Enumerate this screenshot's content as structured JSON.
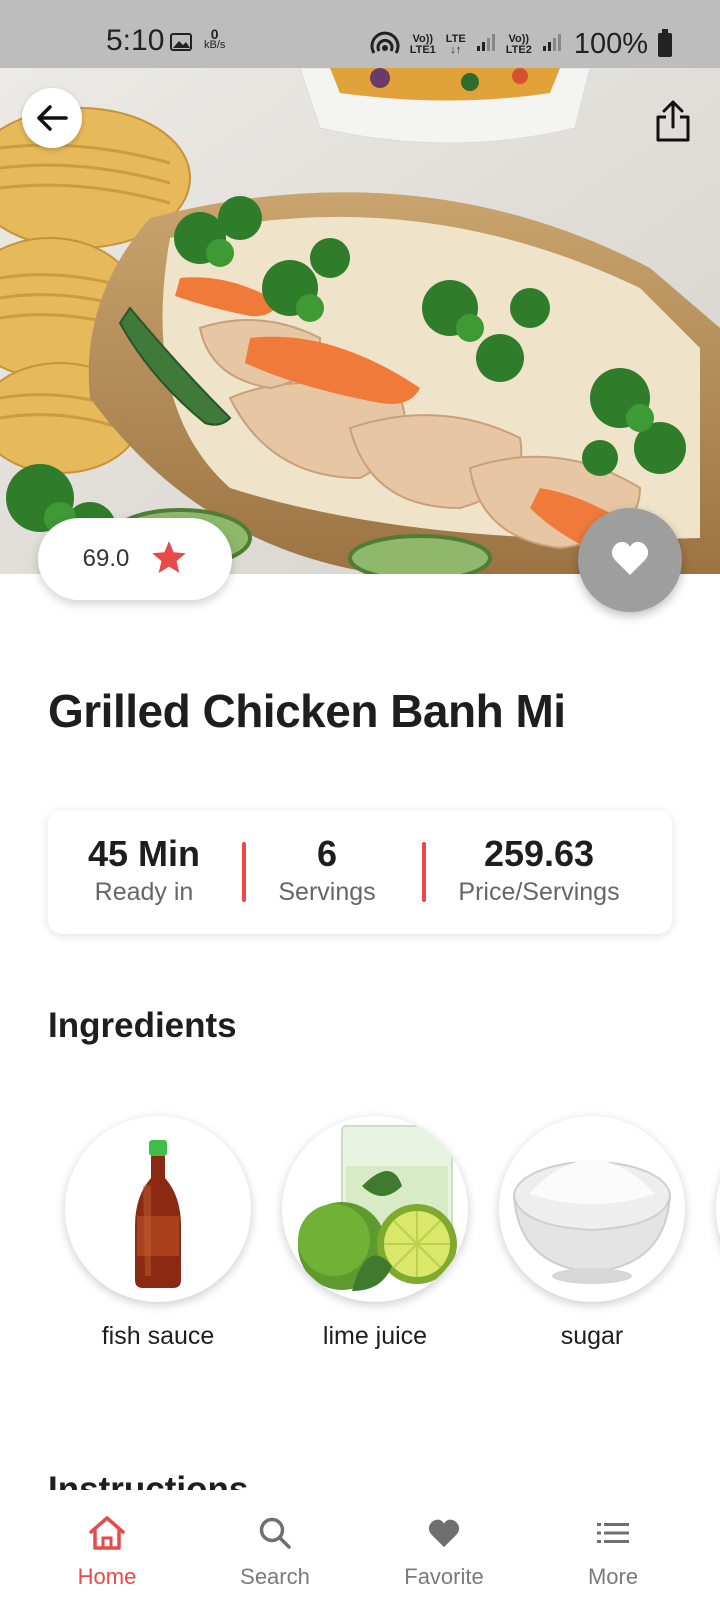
{
  "status_bar": {
    "time": "5:10",
    "data_speed_value": "0",
    "data_speed_unit": "kB/s",
    "sim1_top": "Vo))",
    "sim1_bottom": "LTE1",
    "lte_top": "LTE",
    "lte_bottom": "↓↑",
    "sim2_top": "Vo))",
    "sim2_bottom": "LTE2",
    "battery": "100%",
    "icons": [
      "gallery-icon",
      "hotspot-icon",
      "signal-icon",
      "battery-icon"
    ]
  },
  "hero": {
    "icons": {
      "back": "arrow-left-icon",
      "share": "share-icon"
    }
  },
  "rating": {
    "value": "69.0",
    "icon": "star-icon"
  },
  "favorite": {
    "icon": "heart-icon"
  },
  "recipe": {
    "title": "Grilled Chicken Banh Mi"
  },
  "stats": [
    {
      "value": "45 Min",
      "label": "Ready in"
    },
    {
      "value": "6",
      "label": "Servings"
    },
    {
      "value": "259.63",
      "label": "Price/Servings"
    }
  ],
  "sections": {
    "ingredients": "Ingredients",
    "instructions": "Instructions"
  },
  "ingredients": [
    {
      "name": "fish sauce"
    },
    {
      "name": "lime juice"
    },
    {
      "name": "sugar"
    }
  ],
  "bottom_nav": [
    {
      "label": "Home",
      "icon": "home-icon",
      "active": true
    },
    {
      "label": "Search",
      "icon": "search-icon",
      "active": false
    },
    {
      "label": "Favorite",
      "icon": "heart-icon",
      "active": false
    },
    {
      "label": "More",
      "icon": "list-icon",
      "active": false
    }
  ],
  "colors": {
    "accent": "#e84a4a",
    "fab": "#9e9e9e",
    "status_bar": "#bdbdbd"
  }
}
